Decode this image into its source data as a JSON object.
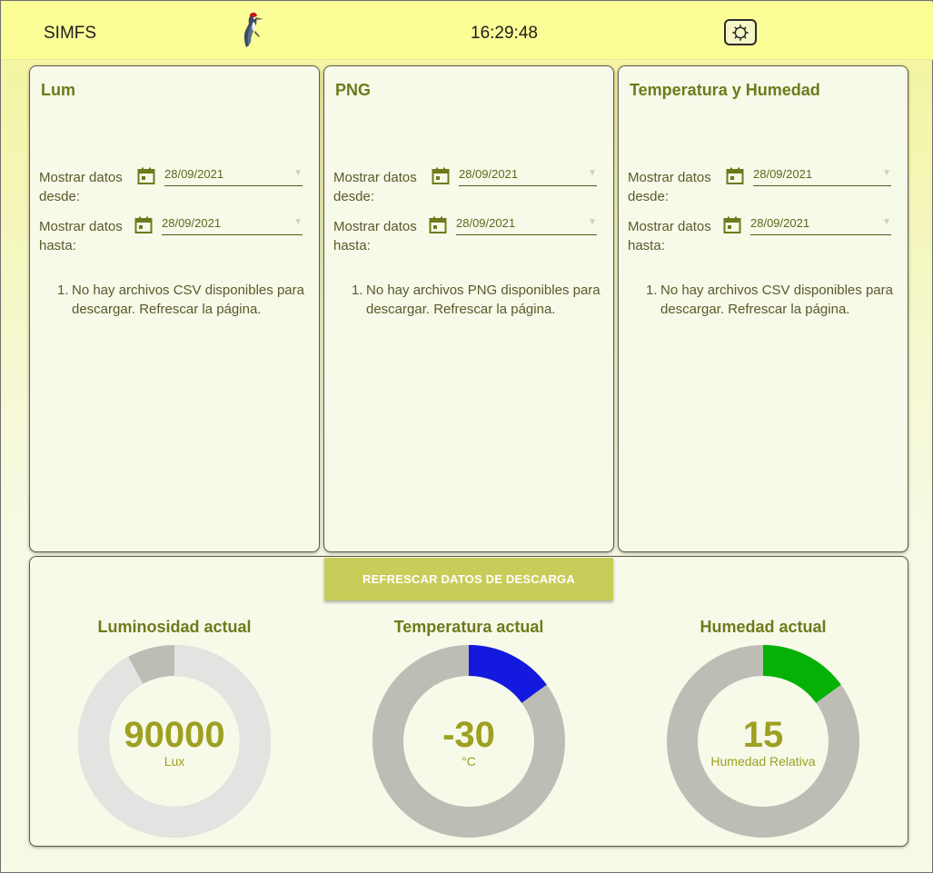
{
  "header": {
    "app_title": "SIMFS",
    "clock": "16:29:48",
    "logo_icon": "woodpecker-logo",
    "settings_icon": "gear-icon"
  },
  "cards": [
    {
      "title": "Lum",
      "from_label": "Mostrar datos desde:",
      "from_date": "28/09/2021",
      "to_label": "Mostrar datos hasta:",
      "to_date": "28/09/2021",
      "message_num": "1.",
      "message": "No hay archivos CSV disponibles para descargar. Refrescar la página."
    },
    {
      "title": "PNG",
      "from_label": "Mostrar datos desde:",
      "from_date": "28/09/2021",
      "to_label": "Mostrar datos hasta:",
      "to_date": "28/09/2021",
      "message_num": "1.",
      "message": "No hay archivos PNG disponibles para descargar. Refrescar la página."
    },
    {
      "title": "Temperatura y Humedad",
      "from_label": "Mostrar datos desde:",
      "from_date": "28/09/2021",
      "to_label": "Mostrar datos hasta:",
      "to_date": "28/09/2021",
      "message_num": "1.",
      "message": "No hay archivos CSV disponibles para descargar. Refrescar la página."
    }
  ],
  "refresh_button": "REFRESCAR DATOS DE DESCARGA",
  "gauges": [
    {
      "title": "Luminosidad actual",
      "value": "90000",
      "unit": "Lux",
      "fill_fraction": 0.92,
      "fill_color": "#e3e3e1",
      "track_color": "#bdbdb6"
    },
    {
      "title": "Temperatura actual",
      "value": "-30",
      "unit": "°C",
      "fill_fraction": 0.15,
      "fill_color": "#1319de",
      "track_color": "#bdbdb6"
    },
    {
      "title": "Humedad actual",
      "value": "15",
      "unit": "Humedad Relativa",
      "fill_fraction": 0.15,
      "fill_color": "#05b105",
      "track_color": "#bdbdb6"
    }
  ],
  "colors": {
    "accent": "#6e7a1b",
    "value_text": "#9da021",
    "button": "#c8cd5a",
    "header_bg": "#fbfd96"
  }
}
